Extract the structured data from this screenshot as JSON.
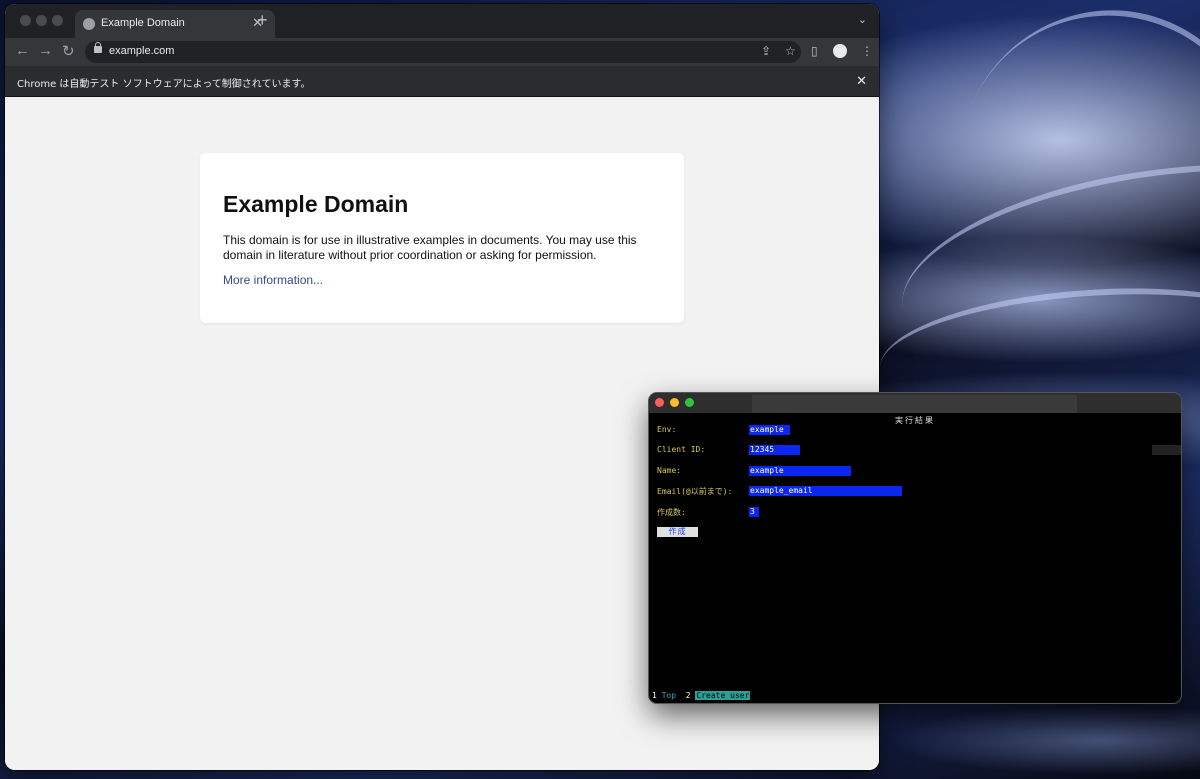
{
  "browser": {
    "tab_title": "Example Domain",
    "new_tab": "+",
    "url": "example.com",
    "infobar_text": "Chrome は自動テスト ソフトウェアによって制御されています。",
    "icons": [
      "back-icon",
      "forward-icon",
      "reload-icon",
      "lock-icon",
      "share-icon",
      "star-icon",
      "sidepanel-icon",
      "profile-icon",
      "menu-icon"
    ]
  },
  "page": {
    "heading": "Example Domain",
    "body": "This domain is for use in illustrative examples in documents. You may use this domain in literature without prior coordination or asking for permission.",
    "link": "More information..."
  },
  "terminal": {
    "title": "実行結果",
    "fields": [
      {
        "label": "Env:",
        "value": "example"
      },
      {
        "label": "Client ID:",
        "value": "12345"
      },
      {
        "label": "Name:",
        "value": "example"
      },
      {
        "label": "Email(@以前まで):",
        "value": "example_email"
      },
      {
        "label": "作成数:",
        "value": "3"
      }
    ],
    "button": "作成",
    "status": {
      "tab1_num": "1",
      "tab1_label": "Top",
      "tab2_num": "2",
      "tab2_label": "Create user"
    }
  },
  "colors": {
    "field_bg": "#0b26f0",
    "label": "#d8c858",
    "link": "#38488f"
  }
}
